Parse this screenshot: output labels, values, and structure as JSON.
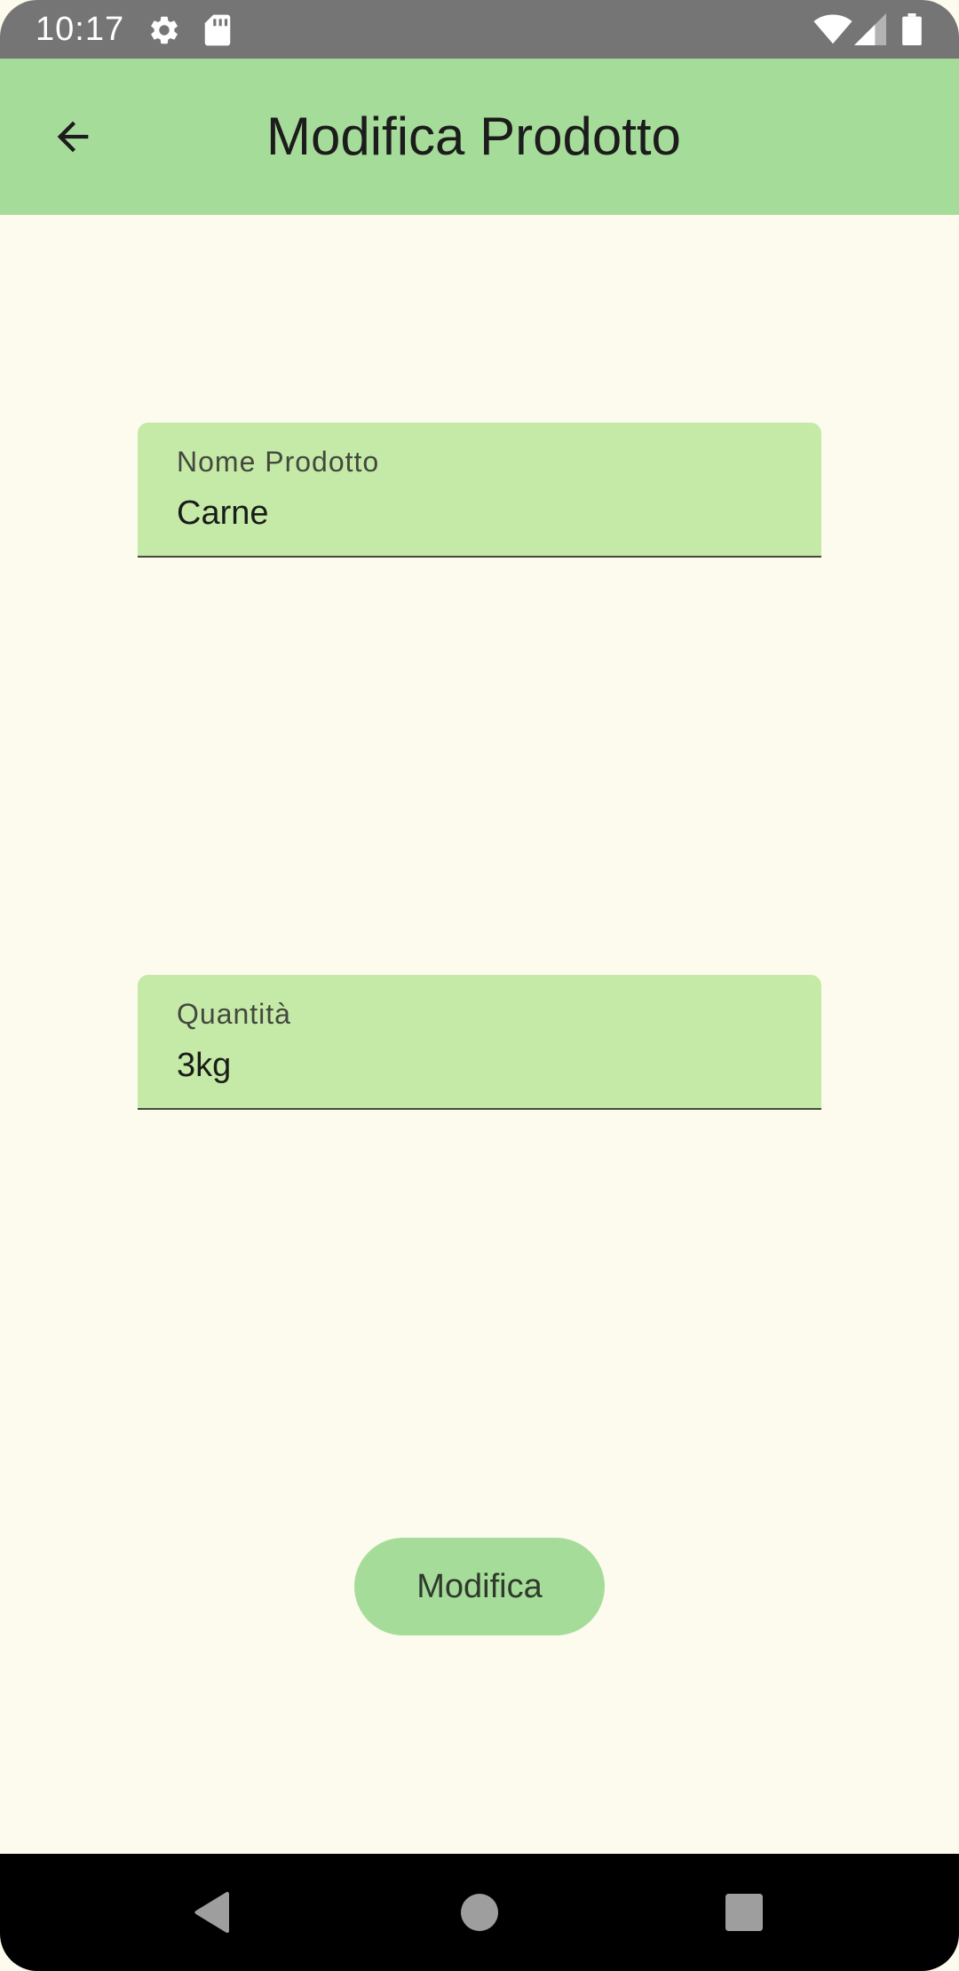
{
  "status_bar": {
    "time": "10:17",
    "icons": [
      "gear-icon",
      "sd-card-icon",
      "wifi-icon",
      "cellular-signal-icon",
      "battery-icon"
    ]
  },
  "app_bar": {
    "back_icon": "arrow-back-icon",
    "title": "Modifica Prodotto"
  },
  "form": {
    "product_name": {
      "label": "Nome Prodotto",
      "value": "Carne"
    },
    "quantity": {
      "label": "Quantità",
      "value": "3kg"
    },
    "submit_label": "Modifica"
  },
  "nav_bar": {
    "icons": [
      "nav-back-icon",
      "nav-home-icon",
      "nav-recents-icon"
    ]
  },
  "colors": {
    "app_bar": "#a6dc9a",
    "background": "#fdfbed",
    "field_fill": "#c5eaa8",
    "button": "#a6dc9a",
    "status_bar": "#757575"
  }
}
